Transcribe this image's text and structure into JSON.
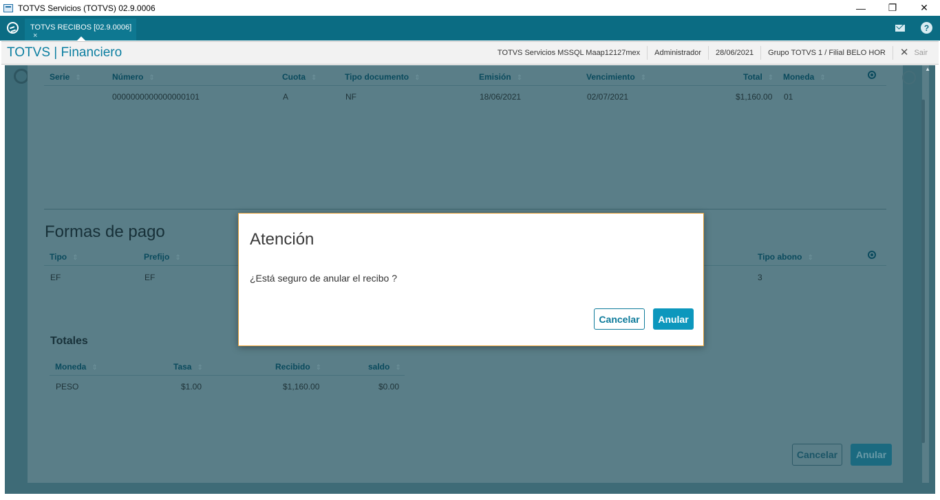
{
  "window": {
    "title": "TOTVS Servicios (TOTVS) 02.9.0006",
    "minimize": "—",
    "restore": "❐",
    "close": "✕"
  },
  "tabbar": {
    "tab_label": "TOTVS RECIBOS [02.9.0006]",
    "tab_close": "×"
  },
  "header": {
    "module_title": "TOTVS | Financiero",
    "environment": "TOTVS Servicios MSSQL Maap12127mex",
    "user": "Administrador",
    "date": "28/06/2021",
    "branch": "Grupo TOTVS 1 / Filial BELO HOR",
    "logout_icon": "✕",
    "logout_label": "Sair"
  },
  "documents_table": {
    "columns": [
      "Serie",
      "Número",
      "Cuota",
      "Tipo documento",
      "Emisión",
      "Vencimiento",
      "Total",
      "Moneda"
    ],
    "rows": [
      {
        "serie": "",
        "numero": "0000000000000000101",
        "cuota": "A",
        "tipo": "NF",
        "emision": "18/06/2021",
        "vencimiento": "02/07/2021",
        "total": "$1,160.00",
        "moneda": "01"
      }
    ]
  },
  "payments": {
    "title": "Formas de pago",
    "columns": [
      "Tipo",
      "Prefijo",
      "Tipo abono"
    ],
    "rows": [
      {
        "tipo": "EF",
        "prefijo": "EF",
        "tipo_abono": "3"
      }
    ]
  },
  "totals": {
    "title": "Totales",
    "columns": [
      "Moneda",
      "Tasa",
      "Recibido",
      "saldo"
    ],
    "rows": [
      {
        "moneda": "PESO",
        "tasa": "$1.00",
        "recibido": "$1,160.00",
        "saldo": "$0.00"
      }
    ]
  },
  "page_actions": {
    "cancel_label": "Cancelar",
    "void_label": "Anular"
  },
  "dialog": {
    "title": "Atención",
    "message": "¿Está seguro de anular el recibo ?",
    "cancel_label": "Cancelar",
    "confirm_label": "Anular"
  },
  "icons": {
    "sort": "⇕",
    "help": "?",
    "scroll_up": "▲"
  },
  "colors": {
    "brand": "#0b6c83",
    "primary_button": "#0c97bd",
    "dialog_border": "#e6a23a",
    "overlay": "#5a7e88"
  }
}
